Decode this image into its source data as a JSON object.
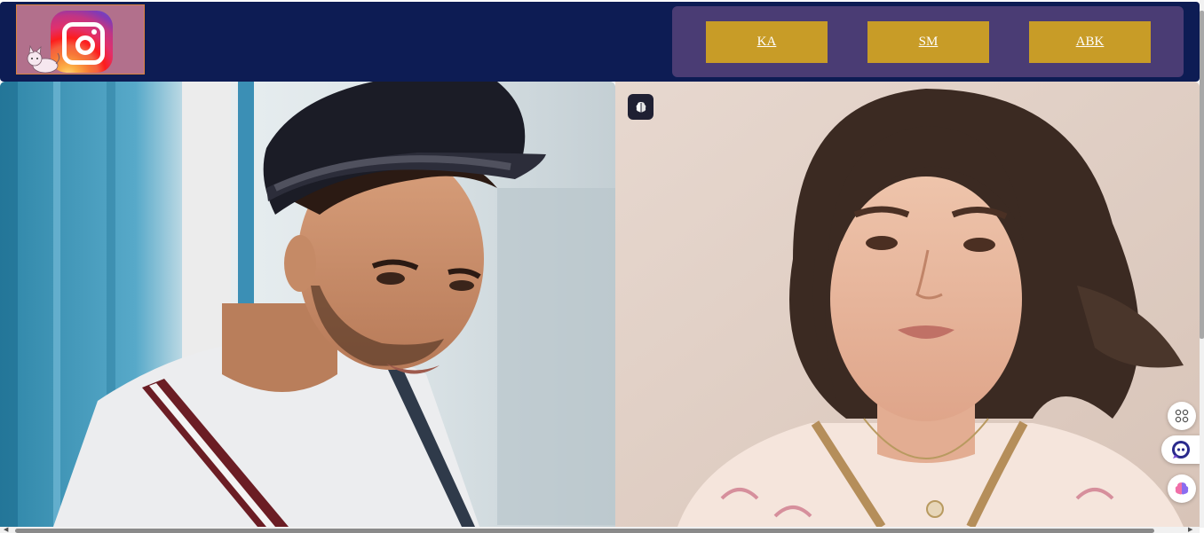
{
  "header": {
    "logo_icon": "instagram-logo-icon",
    "nav": [
      {
        "label": "KA"
      },
      {
        "label": "SM"
      },
      {
        "label": "ABK"
      }
    ]
  },
  "gallery": {
    "images": [
      {
        "alt": "man-in-fedora-photo"
      },
      {
        "alt": "woman-portrait-photo"
      }
    ],
    "badge_icon": "brain-icon"
  },
  "floating_widgets": [
    {
      "icon": "apps-grid-icon"
    },
    {
      "icon": "assistant-bot-icon"
    },
    {
      "icon": "brain-icon"
    }
  ],
  "colors": {
    "header_bg": "#0d1c54",
    "nav_panel_bg": "#4a3c74",
    "nav_button_bg": "#c89c27",
    "logo_box_bg": "#b2708c"
  }
}
